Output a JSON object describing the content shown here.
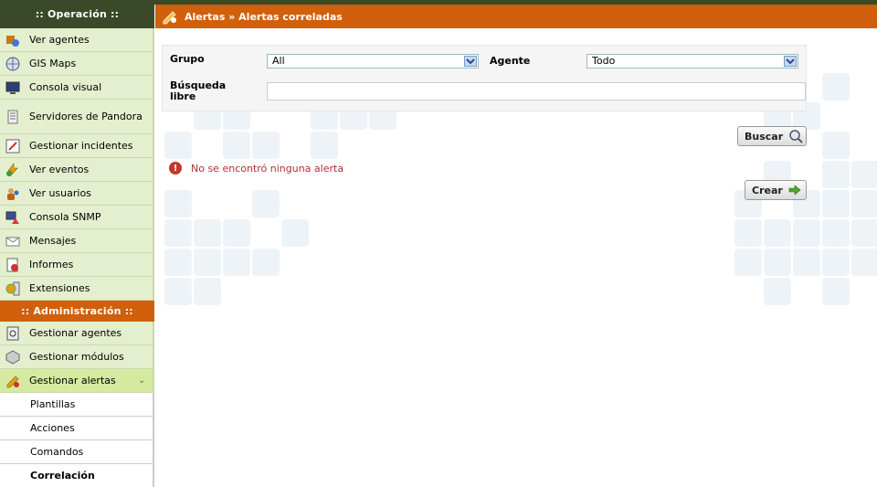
{
  "sidebar": {
    "operation_header": ":: Operación ::",
    "operation_items": [
      {
        "label": "Ver agentes",
        "icon": "agents-icon"
      },
      {
        "label": "GIS Maps",
        "icon": "globe-icon"
      },
      {
        "label": "Consola visual",
        "icon": "monitor-icon"
      },
      {
        "label": "Servidores de Pandora",
        "icon": "server-icon"
      },
      {
        "label": "Gestionar incidentes",
        "icon": "incident-icon"
      },
      {
        "label": "Ver eventos",
        "icon": "events-icon"
      },
      {
        "label": "Ver usuarios",
        "icon": "users-icon"
      },
      {
        "label": "Consola SNMP",
        "icon": "snmp-icon"
      },
      {
        "label": "Mensajes",
        "icon": "envelope-icon"
      },
      {
        "label": "Informes",
        "icon": "report-icon"
      },
      {
        "label": "Extensiones",
        "icon": "extensions-icon"
      }
    ],
    "admin_header": ":: Administración ::",
    "admin_items": [
      {
        "label": "Gestionar agentes",
        "icon": "manage-agents-icon"
      },
      {
        "label": "Gestionar módulos",
        "icon": "modules-icon"
      },
      {
        "label": "Gestionar alertas",
        "icon": "alerts-icon"
      }
    ],
    "alert_subitems": [
      "Plantillas",
      "Acciones",
      "Comandos",
      "Correlación"
    ]
  },
  "header": {
    "title": "Alertas » Alertas correladas"
  },
  "filter": {
    "group_label": "Grupo",
    "group_value": "All",
    "agent_label": "Agente",
    "agent_value": "Todo",
    "search_label": "Búsqueda libre",
    "search_value": ""
  },
  "buttons": {
    "search": "Buscar",
    "create": "Crear"
  },
  "message": {
    "error": "No se encontró ninguna alerta"
  },
  "colors": {
    "accent_orange": "#d0600c",
    "dark_green": "#3a4a28",
    "menu_green": "#e4efcf",
    "error_red": "#b03030"
  }
}
